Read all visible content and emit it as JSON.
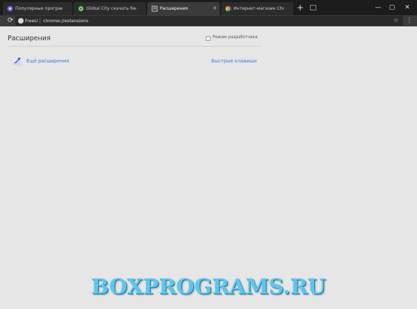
{
  "tabs": [
    {
      "title": "Популярные программы для П",
      "favicon": "app-icon",
      "active": false
    },
    {
      "title": "Global City скачать бесплатно",
      "favicon": "globe-icon",
      "active": false
    },
    {
      "title": "Расширения",
      "favicon": "extensions-page-icon",
      "active": true
    },
    {
      "title": "Интернет-магазин Chrome - Ра",
      "favicon": "chrome-store-icon",
      "active": false
    }
  ],
  "toolbar": {
    "proxy_label": "FreeU",
    "url": "chrome://extensions"
  },
  "page": {
    "title": "Расширения",
    "dev_mode_label": "Режим разработчика",
    "dev_mode_checked": false,
    "more_extensions": "Ещё расширения",
    "keyboard_shortcuts": "Быстрые клавиши"
  },
  "watermark": "BOXPROGRAMS.RU",
  "colors": {
    "tabstrip": "#1c1c1c",
    "toolbar": "#3b3b3b",
    "content_bg": "#e6e6e6",
    "link": "#3b78e7"
  }
}
